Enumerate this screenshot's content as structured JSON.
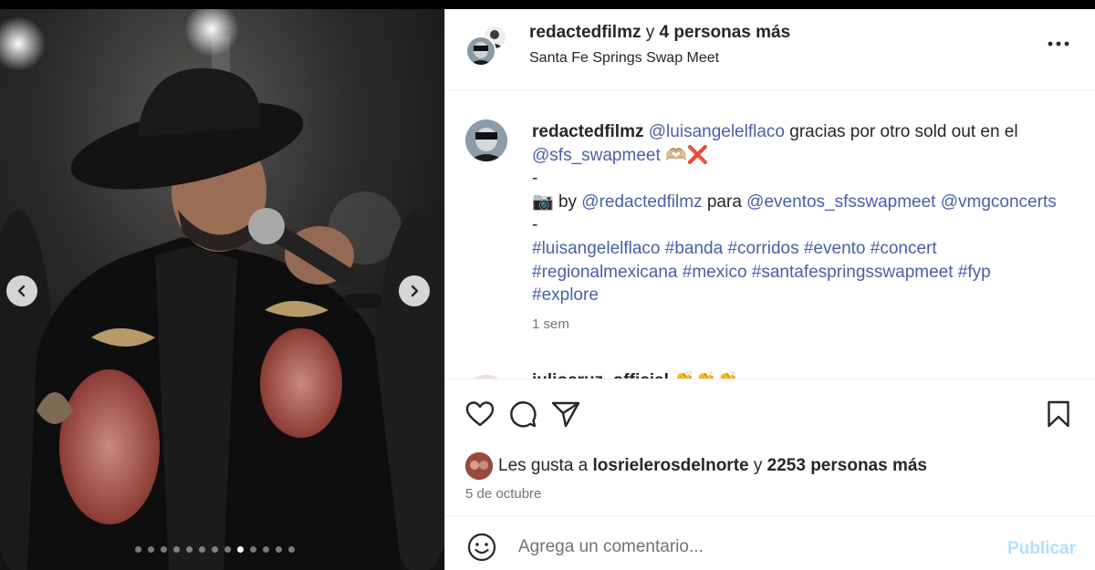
{
  "post": {
    "header": {
      "username": "redactedfilmz",
      "connector": "y",
      "others": "4 personas más",
      "location": "Santa Fe Springs Swap Meet"
    },
    "carousel": {
      "slide_count": 13,
      "active_index": 8
    },
    "caption": {
      "username": "redactedfilmz",
      "mention1": "@luisangelelflaco",
      "text1": " gracias por otro sold out en el ",
      "mention2": "@sfs_swapmeet",
      "emoji1": " 🫶🏼❌",
      "dash": "-",
      "camera": "📷",
      "by": " by ",
      "mention3": "@redactedfilmz",
      "para": " para ",
      "mention4": "@eventos_sfsswapmeet",
      "mention5": " @vmgconcerts",
      "hashtags_line1": "#luisangelelflaco #banda #corridos #evento #concert",
      "hashtags_line2": "#regionalmexicana #mexico #santafespringsswapmeet #fyp",
      "hashtags_line3": "#explore",
      "time": "1 sem"
    },
    "first_comment": {
      "username": "juliocruz_official",
      "emojis": "👏👏👏"
    },
    "likes": {
      "prefix": "Les gusta a ",
      "user": "losrielerosdelnorte",
      "connector": " y ",
      "count": "2253 personas más"
    },
    "date": "5 de octubre",
    "comment": {
      "placeholder": "Agrega un comentario...",
      "post_label": "Publicar"
    }
  },
  "colors": {
    "link": "#4a5fa8",
    "publish_disabled": "#b2dffc",
    "muted": "#737373"
  },
  "icons": [
    "chevron-left-icon",
    "chevron-right-icon",
    "more-horizontal-icon",
    "heart-icon",
    "comment-icon",
    "share-icon",
    "bookmark-icon",
    "emoji-icon"
  ]
}
